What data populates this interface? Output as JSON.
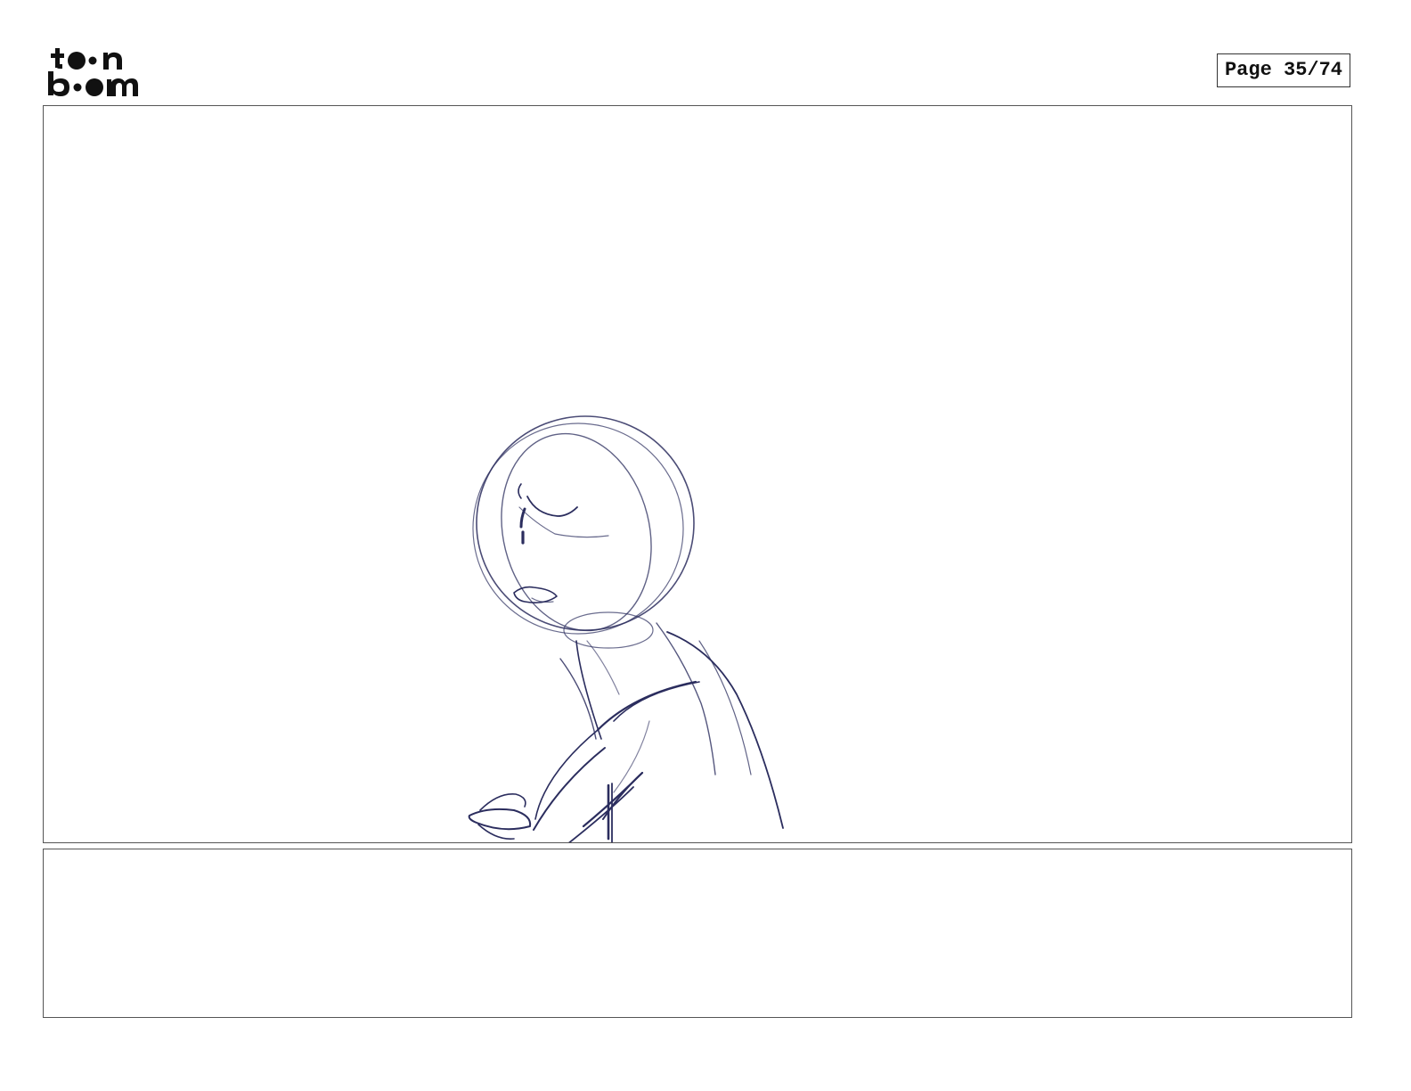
{
  "header": {
    "logo": {
      "line1": "toon",
      "line2": "boom",
      "icon": "toon-boom-logo"
    },
    "page_label": "Page 35/74"
  },
  "panel": {
    "image": "rough-sketch-character-looking-down",
    "stroke_color": "#2b2d5e"
  },
  "dialogue": {
    "text": ""
  }
}
